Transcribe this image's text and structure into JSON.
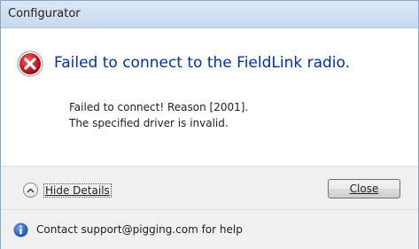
{
  "window": {
    "title": "Configurator"
  },
  "main": {
    "icon": "error-icon",
    "instruction": "Failed to connect to the FieldLink radio.",
    "details": [
      "Failed to connect! Reason [2001].",
      "The specified driver is invalid."
    ]
  },
  "buttons": {
    "expando_label": "Hide Details",
    "expando_access_key": "D",
    "close_label": "Close",
    "close_access_key": "C"
  },
  "footer": {
    "icon": "info-icon",
    "text": "Contact support@pigging.com for help"
  },
  "colors": {
    "instruction": "#003399",
    "error_red": "#c8232c",
    "info_blue": "#2b64c2",
    "title_bar": "#c8d9ef"
  }
}
